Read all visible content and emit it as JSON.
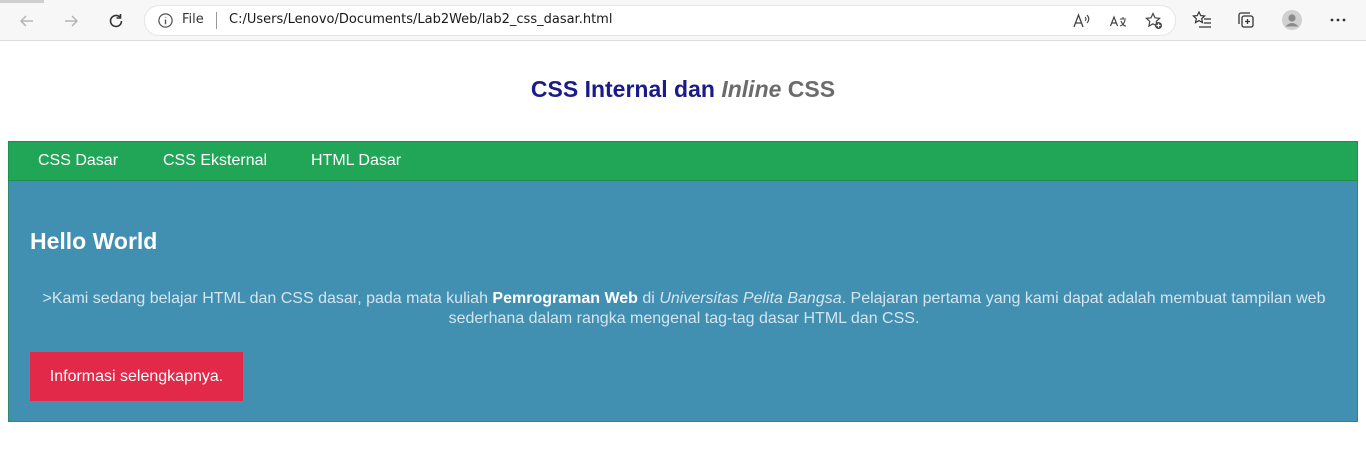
{
  "browser": {
    "file_label": "File",
    "url": "C:/Users/Lenovo/Documents/Lab2Web/lab2_css_dasar.html",
    "icons": [
      "back-icon",
      "forward-icon",
      "refresh-icon",
      "info-icon",
      "read-aloud-icon",
      "translate-icon",
      "add-favorite-icon",
      "favorites-icon",
      "collections-icon",
      "profile-icon",
      "more-icon"
    ]
  },
  "header": {
    "title_main": "CSS Internal dan",
    "title_italic": "Inline",
    "title_tail": "CSS"
  },
  "nav": {
    "items": [
      {
        "label": "CSS Dasar"
      },
      {
        "label": "CSS Eksternal"
      },
      {
        "label": "HTML Dasar"
      }
    ]
  },
  "hero": {
    "heading": "Hello World",
    "text_before": ">Kami sedang belajar HTML dan CSS dasar, pada mata kuliah",
    "bold": "Pemrograman Web",
    "text_middle": "di",
    "italic": "Universitas Pelita Bangsa",
    "text_after": ". Pelajaran pertama yang kami dapat adalah membuat tampilan web sederhana dalam rangka mengenal tag-tag dasar HTML dan CSS.",
    "button_label": "Informasi selengkapnya."
  },
  "colors": {
    "title": "#1a1a8c",
    "navbar": "#21a657",
    "hero": "#418fb1",
    "button": "#e2294a"
  }
}
